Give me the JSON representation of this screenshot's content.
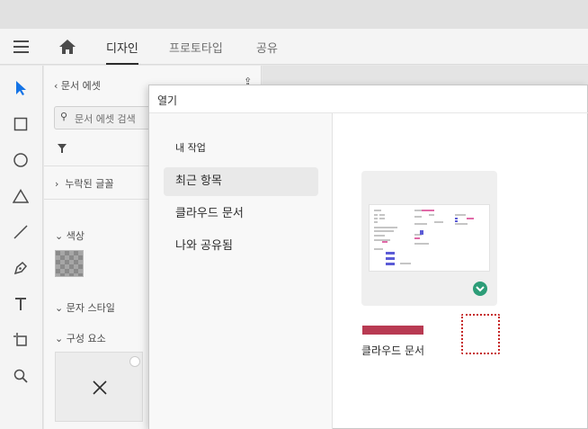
{
  "nav": {
    "tabs": [
      {
        "label": "디자인",
        "active": true
      },
      {
        "label": "프로토타입",
        "active": false
      },
      {
        "label": "공유",
        "active": false
      }
    ]
  },
  "toolbar": {
    "tools": [
      "select-arrow-icon",
      "rectangle-icon",
      "ellipse-icon",
      "triangle-icon",
      "line-icon",
      "pen-icon",
      "text-icon",
      "artboard-icon",
      "zoom-icon"
    ]
  },
  "panel": {
    "back_label": "문서 에셋",
    "search_placeholder": "문서 에셋 검색",
    "missing_fonts": "누락된 글꼴",
    "colors": "색상",
    "char_styles": "문자 스타일",
    "components": "구성 요소"
  },
  "dialog": {
    "title": "열기",
    "section": "내 작업",
    "items": [
      {
        "label": "최근 항목",
        "selected": true
      },
      {
        "label": "클라우드 문서",
        "selected": false
      },
      {
        "label": "나와 공유됨",
        "selected": false
      }
    ],
    "document": {
      "name": "클라우드 문서",
      "bar_color": "#b83a52",
      "status_color": "#2d9d78"
    }
  }
}
